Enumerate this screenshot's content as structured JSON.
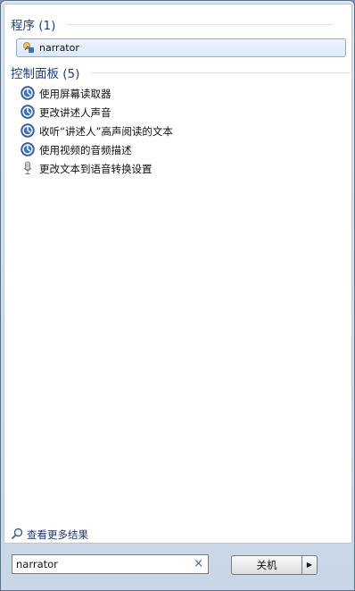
{
  "groups": {
    "programs": {
      "title": "程序 (1)"
    },
    "control_panel": {
      "title": "控制面板 (5)"
    }
  },
  "program_items": [
    {
      "label": "narrator",
      "icon": "narrator-icon"
    }
  ],
  "control_panel_items": [
    {
      "label": "使用屏幕读取器",
      "icon": "ease-of-access-icon"
    },
    {
      "label": "更改讲述人声音",
      "icon": "ease-of-access-icon"
    },
    {
      "label": "收听“讲述人”高声阅读的文本",
      "icon": "ease-of-access-icon"
    },
    {
      "label": "使用视频的音频描述",
      "icon": "ease-of-access-icon"
    },
    {
      "label": "更改文本到语音转换设置",
      "icon": "microphone-icon"
    }
  ],
  "see_more": {
    "label": "查看更多结果"
  },
  "search": {
    "value": "narrator",
    "clear": "×"
  },
  "shutdown": {
    "label": "关机"
  },
  "colors": {
    "accent": "#1e3e8c",
    "selection": "#dbe9f9"
  }
}
